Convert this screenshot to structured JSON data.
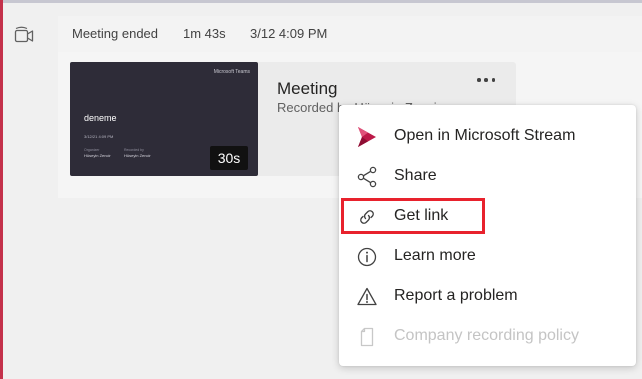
{
  "header": {
    "event_text": "Meeting ended",
    "duration": "1m 43s",
    "datetime": "3/12 4:09 PM"
  },
  "recording": {
    "title": "Meeting",
    "subtitle": "Recorded by Hüseyin Zencir",
    "thumbnail": {
      "brand": "Microsoft Teams",
      "title": "deneme",
      "date": "3/12/21 4:09 PM",
      "organizer_label": "Organizer",
      "organizer_name": "Hüseyin Zencir",
      "recorded_label": "Recorded by",
      "recorded_name": "Hüseyin Zencir"
    },
    "duration_badge": "30s"
  },
  "menu": {
    "items": [
      {
        "label": "Open in Microsoft Stream",
        "icon": "stream-icon",
        "enabled": true
      },
      {
        "label": "Share",
        "icon": "share-icon",
        "enabled": true
      },
      {
        "label": "Get link",
        "icon": "link-icon",
        "enabled": true,
        "highlighted": true
      },
      {
        "label": "Learn more",
        "icon": "info-icon",
        "enabled": true
      },
      {
        "label": "Report a problem",
        "icon": "warning-icon",
        "enabled": true
      },
      {
        "label": "Company recording policy",
        "icon": "document-icon",
        "enabled": false
      }
    ]
  },
  "colors": {
    "accent_left_bar": "#c4314b",
    "stream_brand": "#bc1948",
    "highlight_box": "#e8222d",
    "disabled_text": "#c4c4c4"
  }
}
